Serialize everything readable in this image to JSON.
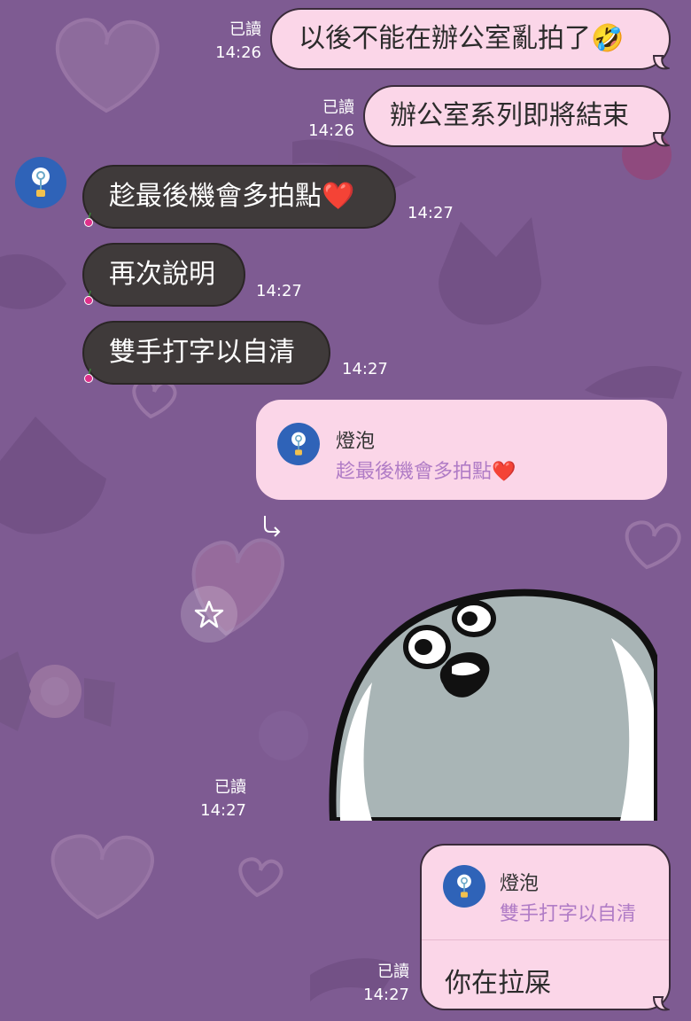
{
  "colors": {
    "background": "#7e5b92",
    "outgoing_bubble": "#fbd6e8",
    "incoming_bubble": "#3f3a3a",
    "quote_text": "#b07cc6",
    "avatar": "#2f63b8"
  },
  "messages": {
    "m1": {
      "text": "以後不能在辦公室亂拍了🤣",
      "read": "已讀",
      "time": "14:26"
    },
    "m2": {
      "text": "辦公室系列即將結束",
      "read": "已讀",
      "time": "14:26"
    },
    "m3": {
      "text": "趁最後機會多拍點❤️",
      "time": "14:27"
    },
    "m4": {
      "text": "再次說明",
      "time": "14:27"
    },
    "m5": {
      "text": "雙手打字以自清",
      "time": "14:27"
    },
    "r1": {
      "sender": "燈泡",
      "quote": "趁最後機會多拍點❤️"
    },
    "sticker": {
      "read": "已讀",
      "time": "14:27"
    },
    "r2": {
      "sender": "燈泡",
      "quote": "雙手打字以自清",
      "text": "你在拉屎",
      "read": "已讀",
      "time": "14:27"
    }
  },
  "icons": {
    "avatar": "lightbulb-icon",
    "reply_arrow": "reply-arrow-icon",
    "star": "star-icon",
    "sticker": "seal-sticker"
  }
}
